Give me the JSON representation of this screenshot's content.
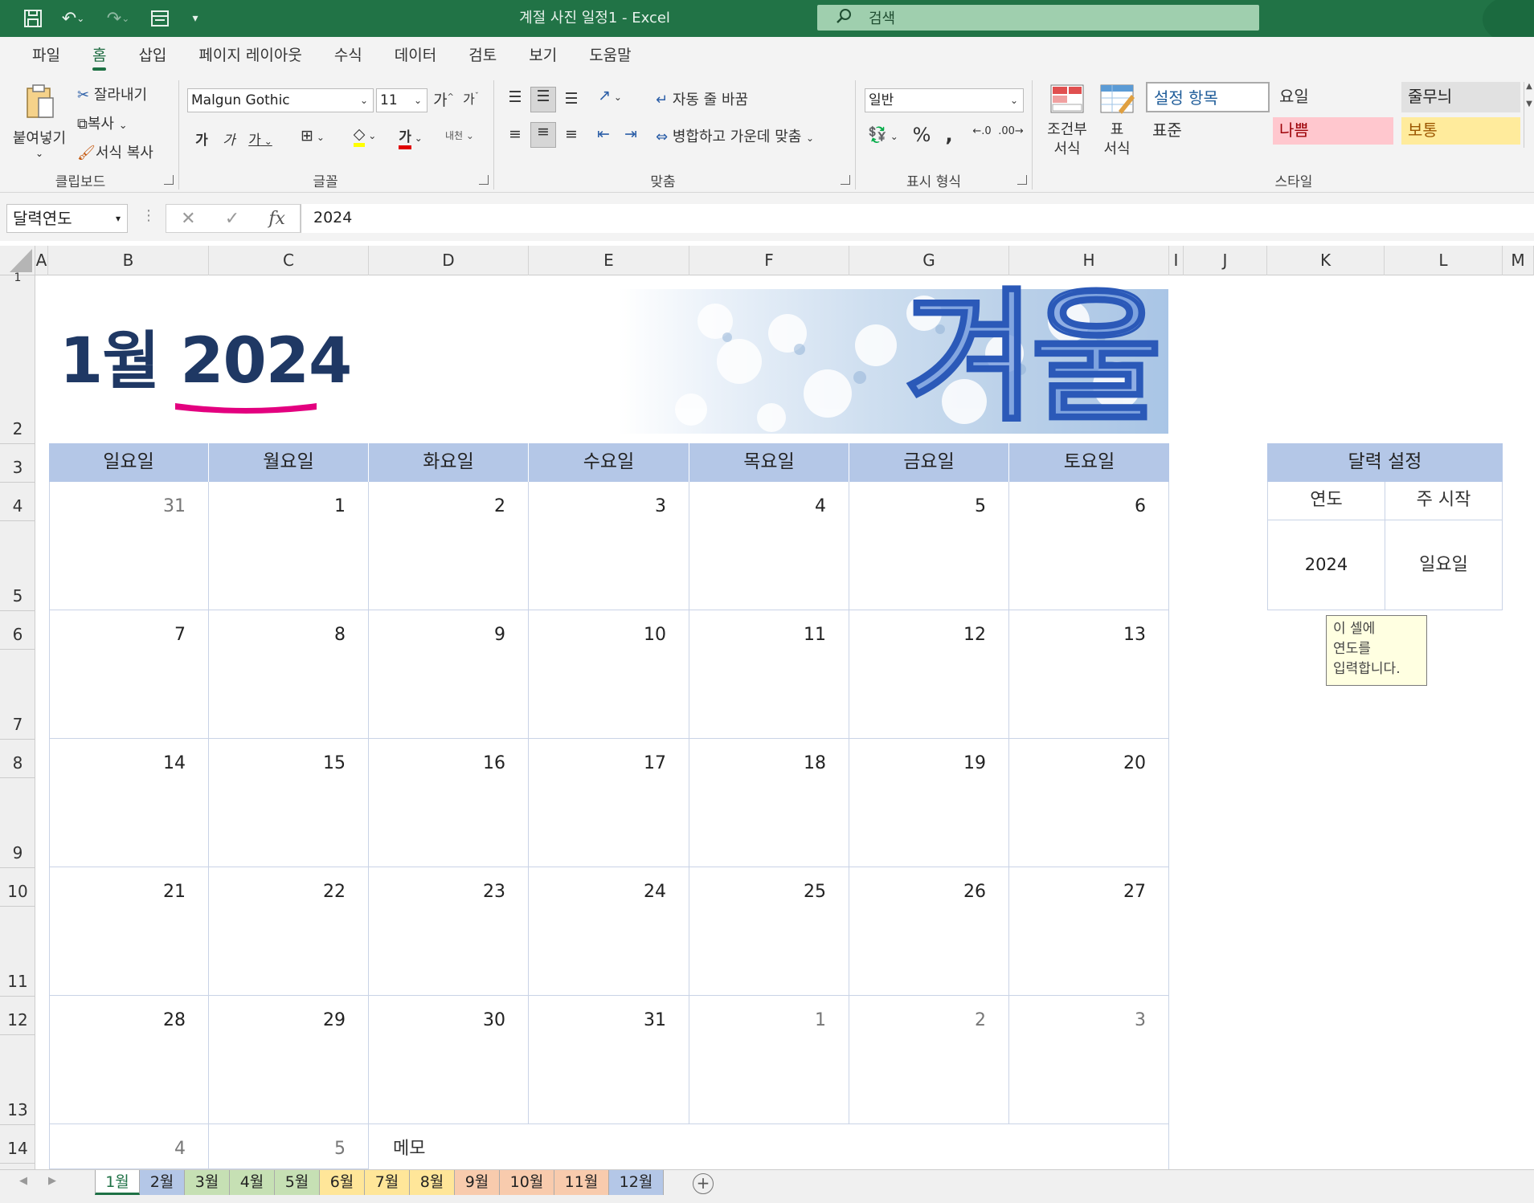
{
  "app": {
    "title": "계절 사진 일정1  -  Excel",
    "search_placeholder": "검색"
  },
  "menu": [
    "파일",
    "홈",
    "삽입",
    "페이지 레이아웃",
    "수식",
    "데이터",
    "검토",
    "보기",
    "도움말"
  ],
  "ribbon": {
    "clipboard": {
      "paste": "붙여넣기",
      "cut": "잘라내기",
      "copy": "복사",
      "format_painter": "서식 복사",
      "label": "클립보드"
    },
    "font": {
      "name": "Malgun Gothic",
      "size": "11",
      "label": "글꼴",
      "bold": "가",
      "italic": "가",
      "underline": "가"
    },
    "alignment": {
      "wrap": "자동 줄 바꿈",
      "merge": "병합하고 가운데 맞춤",
      "label": "맞춤"
    },
    "number": {
      "format": "일반",
      "label": "표시 형식"
    },
    "styles": {
      "conditional": "조건부\n서식",
      "table": "표\n서식",
      "label": "스타일",
      "cells": [
        {
          "text": "설정 항목",
          "bg": "#ffffff",
          "color": "#1f5c99"
        },
        {
          "text": "요일",
          "bg": "#f3f3f3",
          "color": "#333333"
        },
        {
          "text": "줄무늬",
          "bg": "#e1e1e1",
          "color": "#222222"
        },
        {
          "text": "표준",
          "bg": "#f3f3f3",
          "color": "#333333"
        },
        {
          "text": "나쁨",
          "bg": "#ffc7ce",
          "color": "#9c0006"
        },
        {
          "text": "보통",
          "bg": "#ffeb9c",
          "color": "#9c5700"
        }
      ]
    }
  },
  "formula_bar": {
    "name_box": "달력연도",
    "fx": "fx",
    "value": "2024"
  },
  "columns": [
    "A",
    "B",
    "C",
    "D",
    "E",
    "F",
    "G",
    "H",
    "I",
    "J",
    "K",
    "L",
    "M"
  ],
  "rows": [
    "1",
    "2",
    "3",
    "4",
    "5",
    "6",
    "7",
    "8",
    "9",
    "10",
    "11",
    "12",
    "13",
    "14"
  ],
  "calendar": {
    "month": "1월",
    "year": "2024",
    "season": "겨울",
    "weekdays": [
      "일요일",
      "월요일",
      "화요일",
      "수요일",
      "목요일",
      "금요일",
      "토요일"
    ],
    "weeks": [
      [
        {
          "d": "31",
          "dim": true
        },
        {
          "d": "1"
        },
        {
          "d": "2"
        },
        {
          "d": "3"
        },
        {
          "d": "4"
        },
        {
          "d": "5"
        },
        {
          "d": "6"
        }
      ],
      [
        {
          "d": "7"
        },
        {
          "d": "8"
        },
        {
          "d": "9"
        },
        {
          "d": "10"
        },
        {
          "d": "11"
        },
        {
          "d": "12"
        },
        {
          "d": "13"
        }
      ],
      [
        {
          "d": "14"
        },
        {
          "d": "15"
        },
        {
          "d": "16"
        },
        {
          "d": "17"
        },
        {
          "d": "18"
        },
        {
          "d": "19"
        },
        {
          "d": "20"
        }
      ],
      [
        {
          "d": "21"
        },
        {
          "d": "22"
        },
        {
          "d": "23"
        },
        {
          "d": "24"
        },
        {
          "d": "25"
        },
        {
          "d": "26"
        },
        {
          "d": "27"
        }
      ],
      [
        {
          "d": "28"
        },
        {
          "d": "29"
        },
        {
          "d": "30"
        },
        {
          "d": "31"
        },
        {
          "d": "1",
          "dim": true
        },
        {
          "d": "2",
          "dim": true
        },
        {
          "d": "3",
          "dim": true
        }
      ]
    ],
    "extra_days": [
      {
        "d": "4",
        "dim": true
      },
      {
        "d": "5",
        "dim": true
      }
    ],
    "memo_label": "메모"
  },
  "settings": {
    "title": "달력 설정",
    "year_label": "연도",
    "week_start_label": "주 시작",
    "year_value": "2024",
    "week_start_value": "일요일",
    "tooltip": "이 셀에\n연도를\n입력합니다."
  },
  "sheets": [
    {
      "name": "1월",
      "color": "#ffffff",
      "active": true
    },
    {
      "name": "2월",
      "color": "#b4c7e7"
    },
    {
      "name": "3월",
      "color": "#c6e0b4"
    },
    {
      "name": "4월",
      "color": "#c6e0b4"
    },
    {
      "name": "5월",
      "color": "#c6e0b4"
    },
    {
      "name": "6월",
      "color": "#ffe699"
    },
    {
      "name": "7월",
      "color": "#ffe699"
    },
    {
      "name": "8월",
      "color": "#ffe699"
    },
    {
      "name": "9월",
      "color": "#f8cbad"
    },
    {
      "name": "10월",
      "color": "#f8cbad"
    },
    {
      "name": "11월",
      "color": "#f8cbad"
    },
    {
      "name": "12월",
      "color": "#b4c7e7"
    }
  ],
  "colors": {
    "excel_green": "#217346",
    "header_blue": "#b4c7e7",
    "title_navy": "#1f3864",
    "underline_pink": "#e3007f"
  }
}
